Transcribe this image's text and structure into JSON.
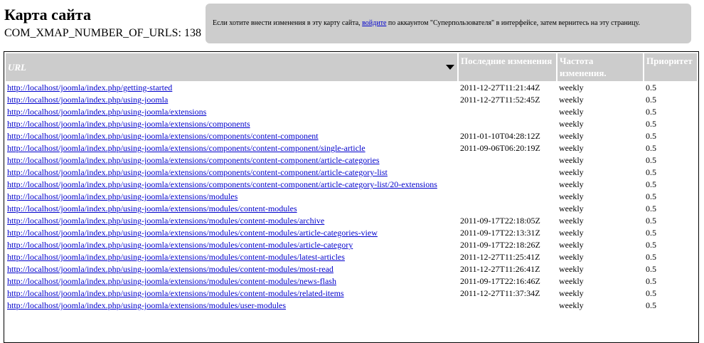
{
  "page": {
    "title": "Карта сайта",
    "url_count_text": "COM_XMAP_NUMBER_OF_URLS: 138"
  },
  "notice": {
    "before": "Если хотите внести изменения в эту карту сайта, ",
    "link": "войдите",
    "after": " по аккаунтом \"Суперпользователя\" в интерфейсе, затем вернитесь на эту страницу."
  },
  "table": {
    "headers": {
      "url": "URL",
      "lastmod": "Последние изменения",
      "changefreq": "Частота изменения.",
      "priority": "Приоритет"
    },
    "rows": [
      {
        "url": "http://localhost/joomla/index.php/getting-started",
        "lastmod": "2011-12-27T11:21:44Z",
        "changefreq": "weekly",
        "priority": "0.5"
      },
      {
        "url": "http://localhost/joomla/index.php/using-joomla",
        "lastmod": "2011-12-27T11:52:45Z",
        "changefreq": "weekly",
        "priority": "0.5"
      },
      {
        "url": "http://localhost/joomla/index.php/using-joomla/extensions",
        "lastmod": "",
        "changefreq": "weekly",
        "priority": "0.5"
      },
      {
        "url": "http://localhost/joomla/index.php/using-joomla/extensions/components",
        "lastmod": "",
        "changefreq": "weekly",
        "priority": "0.5"
      },
      {
        "url": "http://localhost/joomla/index.php/using-joomla/extensions/components/content-component",
        "lastmod": "2011-01-10T04:28:12Z",
        "changefreq": "weekly",
        "priority": "0.5"
      },
      {
        "url": "http://localhost/joomla/index.php/using-joomla/extensions/components/content-component/single-article",
        "lastmod": "2011-09-06T06:20:19Z",
        "changefreq": "weekly",
        "priority": "0.5"
      },
      {
        "url": "http://localhost/joomla/index.php/using-joomla/extensions/components/content-component/article-categories",
        "lastmod": "",
        "changefreq": "weekly",
        "priority": "0.5"
      },
      {
        "url": "http://localhost/joomla/index.php/using-joomla/extensions/components/content-component/article-category-list",
        "lastmod": "",
        "changefreq": "weekly",
        "priority": "0.5"
      },
      {
        "url": "http://localhost/joomla/index.php/using-joomla/extensions/components/content-component/article-category-list/20-extensions",
        "lastmod": "",
        "changefreq": "weekly",
        "priority": "0.5"
      },
      {
        "url": "http://localhost/joomla/index.php/using-joomla/extensions/modules",
        "lastmod": "",
        "changefreq": "weekly",
        "priority": "0.5"
      },
      {
        "url": "http://localhost/joomla/index.php/using-joomla/extensions/modules/content-modules",
        "lastmod": "",
        "changefreq": "weekly",
        "priority": "0.5"
      },
      {
        "url": "http://localhost/joomla/index.php/using-joomla/extensions/modules/content-modules/archive",
        "lastmod": "2011-09-17T22:18:05Z",
        "changefreq": "weekly",
        "priority": "0.5"
      },
      {
        "url": "http://localhost/joomla/index.php/using-joomla/extensions/modules/content-modules/article-categories-view",
        "lastmod": "2011-09-17T22:13:31Z",
        "changefreq": "weekly",
        "priority": "0.5"
      },
      {
        "url": "http://localhost/joomla/index.php/using-joomla/extensions/modules/content-modules/article-category",
        "lastmod": "2011-09-17T22:18:26Z",
        "changefreq": "weekly",
        "priority": "0.5"
      },
      {
        "url": "http://localhost/joomla/index.php/using-joomla/extensions/modules/content-modules/latest-articles",
        "lastmod": "2011-12-27T11:25:41Z",
        "changefreq": "weekly",
        "priority": "0.5"
      },
      {
        "url": "http://localhost/joomla/index.php/using-joomla/extensions/modules/content-modules/most-read",
        "lastmod": "2011-12-27T11:26:41Z",
        "changefreq": "weekly",
        "priority": "0.5"
      },
      {
        "url": "http://localhost/joomla/index.php/using-joomla/extensions/modules/content-modules/news-flash",
        "lastmod": "2011-09-17T22:16:46Z",
        "changefreq": "weekly",
        "priority": "0.5"
      },
      {
        "url": "http://localhost/joomla/index.php/using-joomla/extensions/modules/content-modules/related-items",
        "lastmod": "2011-12-27T11:37:34Z",
        "changefreq": "weekly",
        "priority": "0.5"
      },
      {
        "url": "http://localhost/joomla/index.php/using-joomla/extensions/modules/user-modules",
        "lastmod": "",
        "changefreq": "weekly",
        "priority": "0.5"
      }
    ]
  },
  "icons": {
    "sort": "sort-desc-triangle-icon"
  },
  "colors": {
    "header_bg": "#cccccc",
    "notice_bg": "#cdcdcd",
    "link": "#0000cc"
  }
}
